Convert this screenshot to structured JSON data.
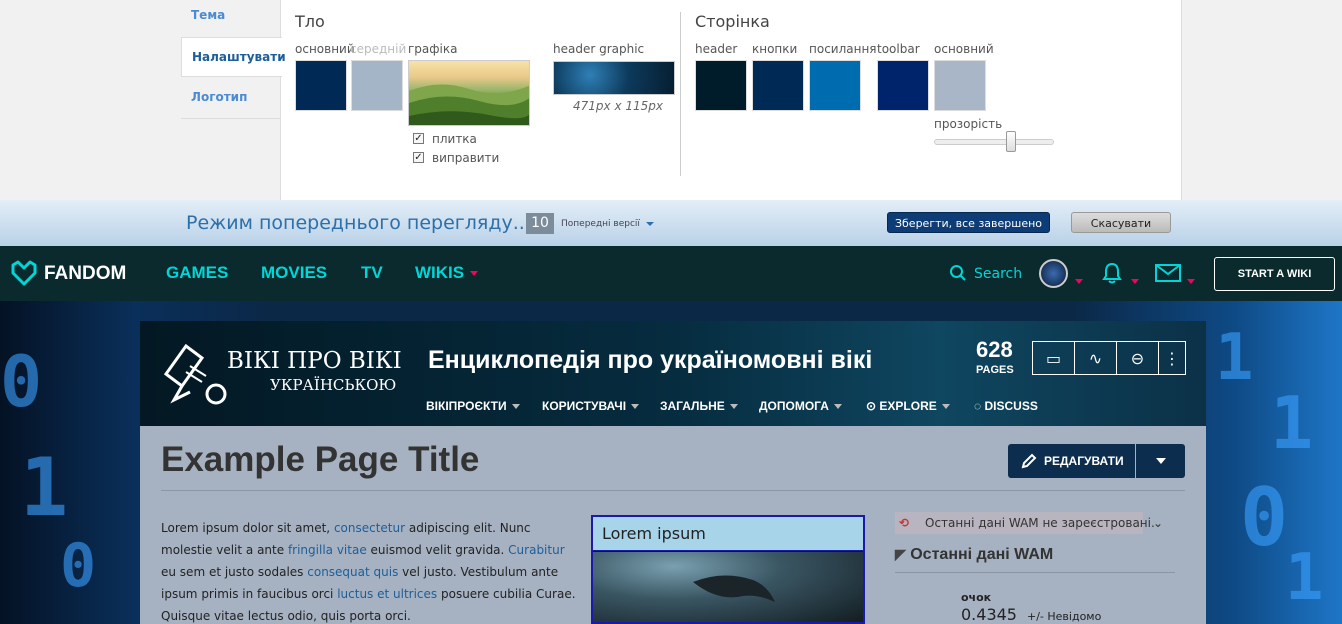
{
  "designer": {
    "tabs": [
      "Тема",
      "Налаштувати",
      "Логотип"
    ],
    "background": {
      "heading": "Тло",
      "main_label": "основний",
      "middle_label": "середній",
      "graphic_label": "графіка",
      "header_graphic_label": "header graphic",
      "header_graphic_size": "471px x 115px",
      "tile_label": "плитка",
      "fix_label": "виправити",
      "colors": {
        "main": "#002a55",
        "middle": "#a4b5c7"
      }
    },
    "page": {
      "heading": "Сторінка",
      "header_label": "header",
      "buttons_label": "кнопки",
      "links_label": "посилання",
      "toolbar_label": "toolbar",
      "main_label": "основний",
      "opacity_label": "прозорість",
      "opacity_value": 0.65,
      "colors": {
        "header": "#001c2a",
        "buttons": "#002a56",
        "links": "#006cb0",
        "toolbar": "#00246b",
        "main": "#a8b6c8"
      }
    }
  },
  "preview": {
    "title": "Режим попереднього перегляду...",
    "revision_count": "10",
    "revisions_label": "Попередні версії",
    "save_label": "Зберегти, все завершено",
    "cancel_label": "Скасувати"
  },
  "fandom_nav": {
    "logo": "FANDOM",
    "links": [
      "GAMES",
      "MOVIES",
      "TV",
      "WIKIS"
    ],
    "search_label": "Search",
    "start_wiki": "START A WIKI"
  },
  "wiki": {
    "wordmark_line1": "ВІКІ ПРО ВІКІ",
    "wordmark_line2": "УКРАЇНСЬКОЮ",
    "title": "Енциклопедія про україномовні вікі",
    "pages_count": "628",
    "pages_label": "PAGES",
    "nav": [
      "ВІКІПРОЄКТИ",
      "КОРИСТУВАЧІ",
      "ЗАГАЛЬНЕ",
      "ДОПОМОГА",
      "EXPLORE",
      "DISCUSS"
    ]
  },
  "article": {
    "title": "Example Page Title",
    "edit_label": "РЕДАГУВАТИ",
    "body": {
      "t1": "Lorem ipsum dolor sit amet, ",
      "l1": "consectetur",
      "t2": " adipiscing elit. Nunc molestie velit a ante ",
      "l2": "fringilla vitae",
      "t3": " euismod velit gravida. ",
      "l3": "Curabitur",
      "t4": " eu sem et justo sodales ",
      "l4": "consequat quis",
      "t5": " vel justo. Vestibulum ante ipsum primis in faucibus orci ",
      "l5": "luctus et ultrices",
      "t6": " posuere cubilia Curae. Quisque vitae lectus odio, quis porta orci."
    },
    "infobox_title": "Lorem ipsum",
    "wam_warning": "Останні дані WAM не зареєстровані.",
    "wam_heading": "Останні дані WAM",
    "wam_score_label": "очок",
    "wam_score": "0.4345",
    "wam_delta": "+/- Невідомо"
  }
}
